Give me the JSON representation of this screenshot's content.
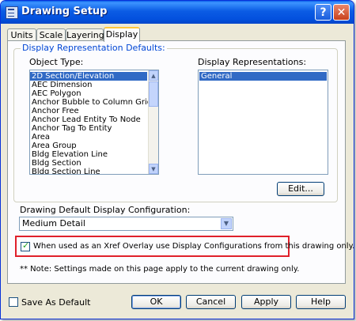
{
  "window": {
    "title": "Drawing Setup"
  },
  "tabs": [
    {
      "label": "Units"
    },
    {
      "label": "Scale"
    },
    {
      "label": "Layering"
    },
    {
      "label": "Display",
      "active": true
    }
  ],
  "group": {
    "label": "Display Representation Defaults:"
  },
  "object_type": {
    "label": "Object Type:",
    "items": [
      "2D Section/Elevation",
      "AEC Dimension",
      "AEC Polygon",
      "Anchor Bubble to Column Grid",
      "Anchor Free",
      "Anchor Lead Entity To Node",
      "Anchor Tag To Entity",
      "Area",
      "Area Group",
      "Bldg Elevation Line",
      "Bldg Section",
      "Bldg Section Line"
    ],
    "selected": "2D Section/Elevation"
  },
  "display_reps": {
    "label": "Display Representations:",
    "items": [
      "General"
    ],
    "selected": "General"
  },
  "edit_button": {
    "label": "Edit..."
  },
  "config": {
    "label": "Drawing Default Display Configuration:",
    "value": "Medium Detail"
  },
  "xref": {
    "label": "When used as an Xref Overlay use Display Configurations from this drawing only.",
    "checked": true
  },
  "note": "** Note: Settings made on this page apply to the current drawing only.",
  "save_default": {
    "label": "Save As Default",
    "checked": false
  },
  "footer": {
    "ok": "OK",
    "cancel": "Cancel",
    "apply": "Apply",
    "help": "Help"
  },
  "colors": {
    "titlebar": "#0054e3",
    "highlight_box": "#e0202a",
    "selection": "#316ac5",
    "group_label": "#0046d5"
  },
  "icons": [
    "drawing-setup-icon",
    "help-icon",
    "close-icon",
    "scroll-up-icon",
    "scroll-down-icon",
    "dropdown-arrow-icon",
    "checkmark-icon"
  ]
}
